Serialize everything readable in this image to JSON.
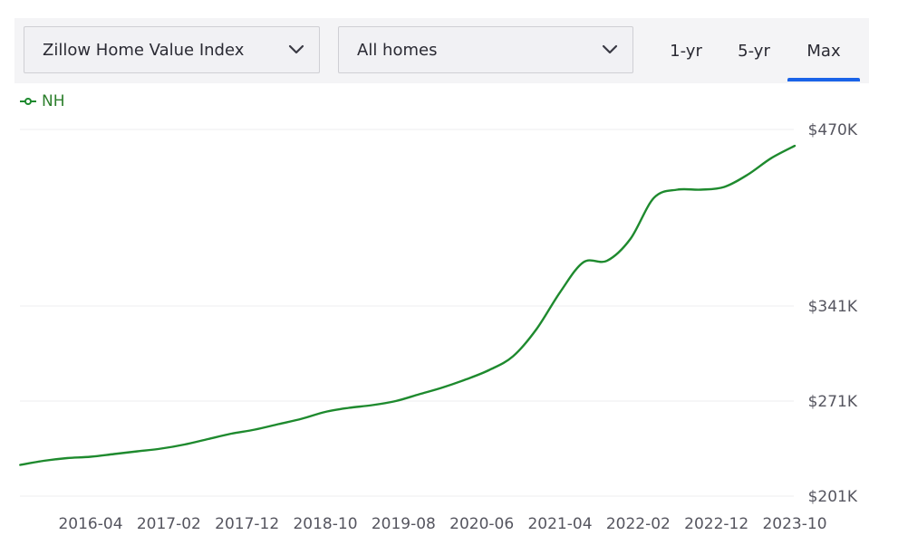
{
  "toolbar": {
    "metric_select": {
      "value": "Zillow Home Value Index",
      "icon": "chevron-down-icon"
    },
    "homes_select": {
      "value": "All homes",
      "icon": "chevron-down-icon"
    },
    "tabs": [
      {
        "label": "1-yr",
        "selected": false
      },
      {
        "label": "5-yr",
        "selected": false
      },
      {
        "label": "Max",
        "selected": true
      }
    ],
    "accent_color": "#1a63e8"
  },
  "legend": {
    "label": "NH",
    "color": "#1e8a2e",
    "icon": "line-marker-icon"
  },
  "chart_data": {
    "type": "line",
    "title": "",
    "xlabel": "",
    "ylabel": "",
    "grid": true,
    "legend_position": "top-left",
    "y_ticks": [
      {
        "value": 201000,
        "label": "$201K"
      },
      {
        "value": 271000,
        "label": "$271K"
      },
      {
        "value": 341000,
        "label": "$341K"
      },
      {
        "value": 470000,
        "label": "$470K"
      }
    ],
    "ylim": [
      201000,
      470000
    ],
    "x_ticks": [
      "2016-04",
      "2017-02",
      "2017-12",
      "2018-10",
      "2019-08",
      "2020-06",
      "2021-04",
      "2022-02",
      "2022-12",
      "2023-10"
    ],
    "xlim": [
      "2015-07",
      "2023-10"
    ],
    "series": [
      {
        "name": "NH",
        "color": "#1e8a2e",
        "points": [
          [
            "2015-07",
            224000
          ],
          [
            "2015-10",
            227000
          ],
          [
            "2016-01",
            229000
          ],
          [
            "2016-04",
            230000
          ],
          [
            "2016-07",
            232000
          ],
          [
            "2016-10",
            234000
          ],
          [
            "2017-01",
            236000
          ],
          [
            "2017-04",
            239000
          ],
          [
            "2017-07",
            243000
          ],
          [
            "2017-10",
            247000
          ],
          [
            "2018-01",
            250000
          ],
          [
            "2018-04",
            254000
          ],
          [
            "2018-07",
            258000
          ],
          [
            "2018-10",
            263000
          ],
          [
            "2019-01",
            266000
          ],
          [
            "2019-04",
            268000
          ],
          [
            "2019-07",
            271000
          ],
          [
            "2019-10",
            276000
          ],
          [
            "2020-01",
            281000
          ],
          [
            "2020-04",
            287000
          ],
          [
            "2020-07",
            294000
          ],
          [
            "2020-10",
            304000
          ],
          [
            "2021-01",
            324000
          ],
          [
            "2021-04",
            351000
          ],
          [
            "2021-07",
            373000
          ],
          [
            "2021-10",
            374000
          ],
          [
            "2022-01",
            390000
          ],
          [
            "2022-04",
            420000
          ],
          [
            "2022-07",
            426000
          ],
          [
            "2022-10",
            426000
          ],
          [
            "2023-01",
            428000
          ],
          [
            "2023-04",
            437000
          ],
          [
            "2023-07",
            449000
          ],
          [
            "2023-10",
            458000
          ]
        ]
      }
    ]
  }
}
